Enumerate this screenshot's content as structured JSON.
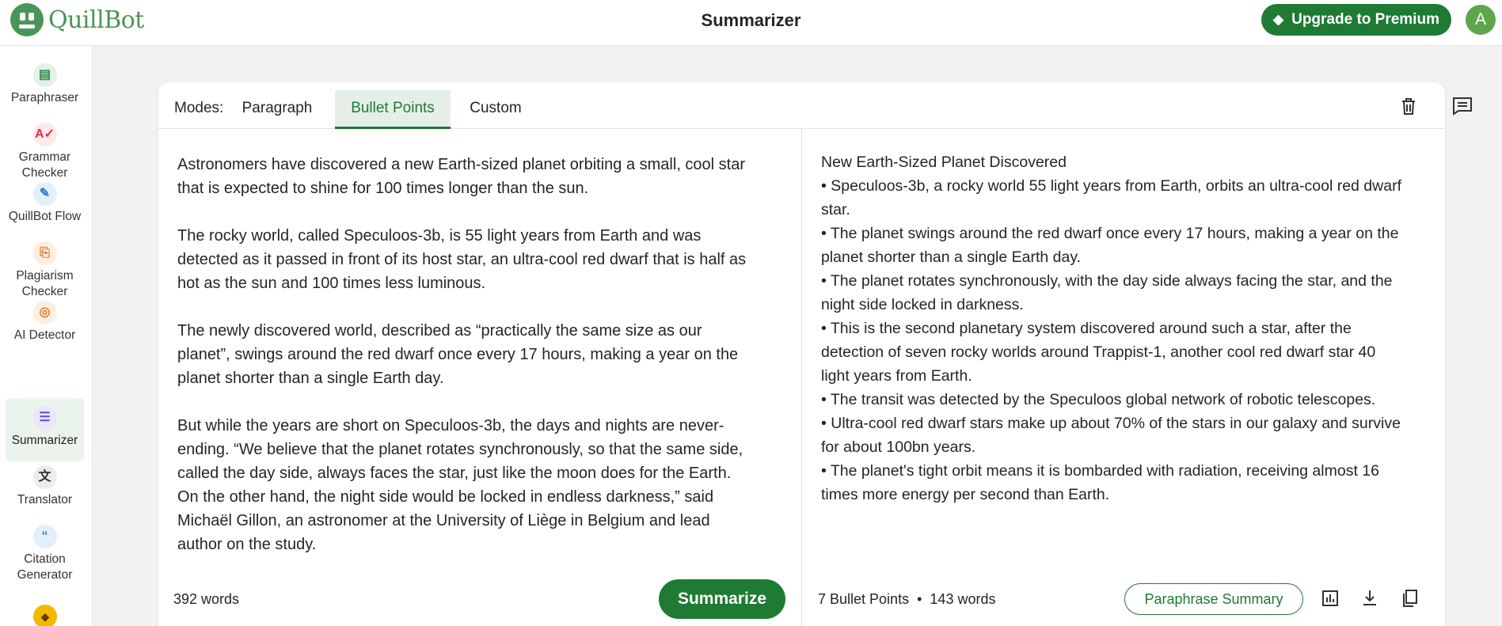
{
  "app": {
    "name": "QuillBot",
    "page_title": "Summarizer"
  },
  "header": {
    "upgrade_label": "Upgrade to Premium",
    "avatar_initial": "A"
  },
  "sidebar": {
    "items": [
      {
        "label": "Paraphraser",
        "icon": "paraphraser-icon"
      },
      {
        "label": "Grammar Checker",
        "icon": "grammar-checker-icon"
      },
      {
        "label": "QuillBot Flow",
        "icon": "flow-icon"
      },
      {
        "label": "Plagiarism Checker",
        "icon": "plagiarism-checker-icon"
      },
      {
        "label": "AI Detector",
        "icon": "ai-detector-icon"
      },
      {
        "label": "Summarizer",
        "icon": "summarizer-icon"
      },
      {
        "label": "Translator",
        "icon": "translator-icon"
      },
      {
        "label": "Citation Generator",
        "icon": "citation-icon"
      }
    ]
  },
  "modes": {
    "label": "Modes:",
    "tabs": [
      "Paragraph",
      "Bullet Points",
      "Custom"
    ],
    "active": "Bullet Points"
  },
  "input": {
    "paragraphs": [
      "Astronomers have discovered a new Earth-sized planet orbiting a small, cool star that is expected to shine for 100 times longer than the sun.",
      "The rocky world, called Speculoos-3b, is 55 light years from Earth and was detected as it passed in front of its host star, an ultra-cool red dwarf that is half as hot as the sun and 100 times less luminous.",
      "The newly discovered world, described as “practically the same size as our planet”, swings around the red dwarf once every 17 hours, making a year on the planet shorter than a single Earth day.",
      "But while the years are short on Speculoos-3b, the days and nights are never-ending. “We believe that the planet rotates synchronously, so that the same side, called the day side, always faces the star, just like the moon does for the Earth. On the other hand, the night side would be locked in endless darkness,” said Michaël Gillon, an astronomer at the University of Liège in Belgium and lead author on the study."
    ],
    "word_count": "392 words",
    "summarize_label": "Summarize"
  },
  "output": {
    "heading": "New Earth-Sized Planet Discovered",
    "bullets": [
      "• Speculoos-3b, a rocky world 55 light years from Earth, orbits an ultra-cool red dwarf star.",
      "• The planet swings around the red dwarf once every 17 hours, making a year on the planet shorter than a single Earth day.",
      "• The planet rotates synchronously, with the day side always facing the star, and the night side locked in darkness.",
      "• This is the second planetary system discovered around such a star, after the detection of seven rocky worlds around Trappist-1, another cool red dwarf star 40 light years from Earth.",
      "• The transit was detected by the Speculoos global network of robotic telescopes.",
      "• Ultra-cool red dwarf stars make up about 70% of the stars in our galaxy and survive for about 100bn years.",
      "• The planet's tight orbit means it is bombarded with radiation, receiving almost 16 times more energy per second than Earth."
    ],
    "bullet_count": "7 Bullet Points",
    "separator": "•",
    "word_count": "143 words",
    "paraphrase_label": "Paraphrase Summary"
  },
  "colors": {
    "brand": "#499557",
    "accent": "#1f7a34",
    "active_bg": "#e6efe7"
  }
}
